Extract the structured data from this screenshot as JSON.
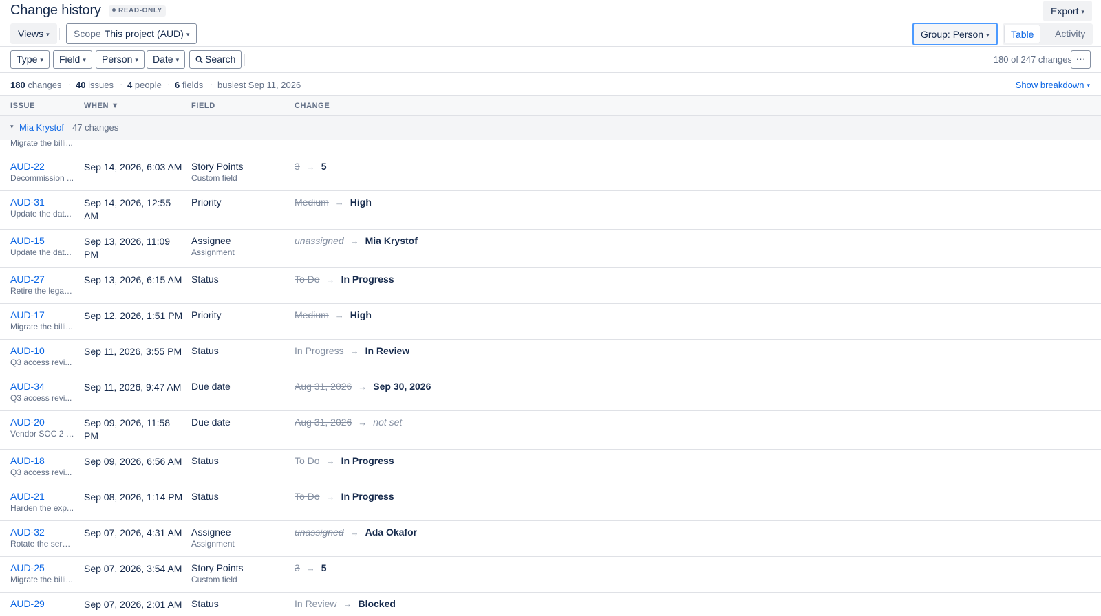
{
  "header": {
    "title": "Change history",
    "badge": "READ-ONLY",
    "export_label": "Export",
    "views_label": "Views",
    "scope_label": "Scope",
    "scope_value": "This project (AUD)",
    "group_label": "Group: Person",
    "view_tabs": [
      "Table",
      "Activity"
    ],
    "active_view": "Table"
  },
  "filters": {
    "buttons": [
      "Type",
      "Field",
      "Person",
      "Date",
      "Search"
    ],
    "count_text": "180 of 247 changes",
    "more_label": "···"
  },
  "summary": {
    "changes_num": "180",
    "changes_label": "changes",
    "issues_num": "40",
    "issues_label": "issues",
    "people_num": "4",
    "people_label": "people",
    "fields_num": "6",
    "fields_label": "fields",
    "busiest": "busiest Sep 11, 2026",
    "breakdown_label": "Show breakdown"
  },
  "columns": [
    "ISSUE",
    "WHEN ▼",
    "FIELD",
    "CHANGE"
  ],
  "group": {
    "name": "Mia Krystof",
    "count": "47 changes",
    "partial_summary": "Migrate the billi..."
  },
  "rows": [
    {
      "key": "AUD-22",
      "summary": "Decommission ...",
      "when": "Sep 14, 2026, 6:03 AM",
      "field": "Story Points",
      "field_sub": "Custom field",
      "old": "3",
      "new": "5"
    },
    {
      "key": "AUD-31",
      "summary": "Update the dat...",
      "when": "Sep 14, 2026, 12:55 AM",
      "field": "Priority",
      "field_sub": "",
      "old": "Medium",
      "new": "High"
    },
    {
      "key": "AUD-15",
      "summary": "Update the dat...",
      "when": "Sep 13, 2026, 11:09 PM",
      "field": "Assignee",
      "field_sub": "Assignment",
      "old": "unassigned",
      "new": "Mia Krystof"
    },
    {
      "key": "AUD-27",
      "summary": "Retire the legac...",
      "when": "Sep 13, 2026, 6:15 AM",
      "field": "Status",
      "field_sub": "",
      "old": "To Do",
      "new": "In Progress"
    },
    {
      "key": "AUD-17",
      "summary": "Migrate the billi...",
      "when": "Sep 12, 2026, 1:51 PM",
      "field": "Priority",
      "field_sub": "",
      "old": "Medium",
      "new": "High"
    },
    {
      "key": "AUD-10",
      "summary": "Q3 access revi...",
      "when": "Sep 11, 2026, 3:55 PM",
      "field": "Status",
      "field_sub": "",
      "old": "In Progress",
      "new": "In Review"
    },
    {
      "key": "AUD-34",
      "summary": "Q3 access revi...",
      "when": "Sep 11, 2026, 9:47 AM",
      "field": "Due date",
      "field_sub": "",
      "old": "Aug 31, 2026",
      "new": "Sep 30, 2026"
    },
    {
      "key": "AUD-20",
      "summary": "Vendor SOC 2 f...",
      "when": "Sep 09, 2026, 11:58 PM",
      "field": "Due date",
      "field_sub": "",
      "old": "Aug 31, 2026",
      "new": "not set"
    },
    {
      "key": "AUD-18",
      "summary": "Q3 access revi...",
      "when": "Sep 09, 2026, 6:56 AM",
      "field": "Status",
      "field_sub": "",
      "old": "To Do",
      "new": "In Progress"
    },
    {
      "key": "AUD-21",
      "summary": "Harden the exp...",
      "when": "Sep 08, 2026, 1:14 PM",
      "field": "Status",
      "field_sub": "",
      "old": "To Do",
      "new": "In Progress"
    },
    {
      "key": "AUD-32",
      "summary": "Rotate the servi...",
      "when": "Sep 07, 2026, 4:31 AM",
      "field": "Assignee",
      "field_sub": "Assignment",
      "old": "unassigned",
      "new": "Ada Okafor"
    },
    {
      "key": "AUD-25",
      "summary": "Migrate the billi...",
      "when": "Sep 07, 2026, 3:54 AM",
      "field": "Story Points",
      "field_sub": "Custom field",
      "old": "3",
      "new": "5"
    },
    {
      "key": "AUD-29",
      "summary": "",
      "when": "Sep 07, 2026, 2:01 AM",
      "field": "Status",
      "field_sub": "",
      "old": "In Review",
      "new": "Blocked"
    }
  ],
  "colors": {
    "accent": "#0c66e4",
    "text": "#172b4d",
    "muted": "#626f86",
    "border": "#dfe1e6",
    "focus": "#4c9aff"
  },
  "icons": [
    "caret-down-icon",
    "search-icon",
    "more-icon",
    "dot-icon",
    "arrow-right-icon"
  ]
}
